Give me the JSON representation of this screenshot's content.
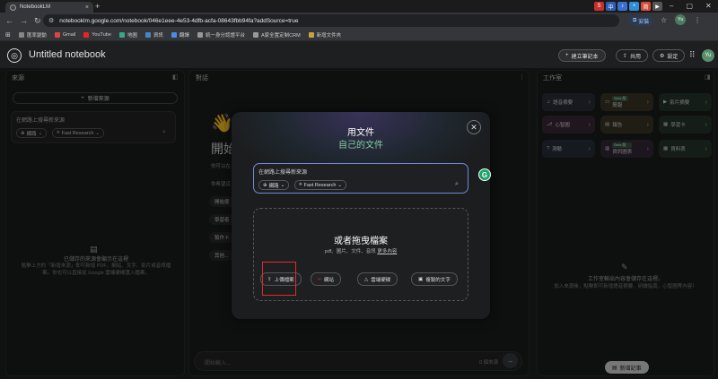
{
  "browser": {
    "tab_title": "NotebookLM",
    "url": "notebooklm.google.com/notebook/046e1eee-4e53-4dfb-acfa-08643fbb94fa?addSource=true",
    "install_label": "安裝",
    "profile_initials": "Yu",
    "extensions": [
      "S",
      "中",
      "♪",
      "•",
      "简",
      "▶"
    ],
    "bookmarks": [
      "匯率變動",
      "Gmail",
      "YouTube",
      "地圖",
      "資訊",
      "翻譯",
      "統一身分認證平台",
      "A家全置定制CRM",
      "新增文件夾"
    ]
  },
  "app": {
    "notebook_title": "Untitled notebook",
    "create_label": "建立筆記本",
    "share_label": "共用",
    "settings_label": "設定",
    "avatar_initials": "Yu"
  },
  "sources": {
    "header": "來源",
    "add_label": "新增來源",
    "search_placeholder": "在網路上搜尋新來源",
    "chip_web": "網路",
    "chip_fast": "Fast Research",
    "empty_title": "已儲存的來源會顯示在這裡",
    "empty_desc_1": "點擊上方的「新增來源」即可新增 PDF、網站、文字、影片或音訊檔",
    "empty_desc_2": "案。你也可以直接從 Google 雲端硬碟匯入檔案。"
  },
  "chat": {
    "header": "對話",
    "big_title": "開始",
    "sub1": "你可以在",
    "sub2": "你希望這",
    "chips": [
      "開始使",
      "學習者",
      "製作 F",
      "其他..."
    ],
    "input_placeholder": "開始輸入...",
    "source_count": "0 個來源"
  },
  "studio": {
    "header": "工作室",
    "tiles": [
      {
        "label": "語音摘要",
        "icon": "♫",
        "color": "#2b2f3a",
        "beta": ""
      },
      {
        "label": "簡報",
        "icon": "▭",
        "color": "#3a3525",
        "beta": "Beta 版"
      },
      {
        "label": "影片摘要",
        "icon": "▶",
        "color": "#25352b",
        "beta": ""
      },
      {
        "label": "心智圖",
        "icon": "⎇",
        "color": "#3a2b36",
        "beta": ""
      },
      {
        "label": "報告",
        "icon": "▤",
        "color": "#3a3525",
        "beta": ""
      },
      {
        "label": "學習卡",
        "icon": "▦",
        "color": "#25352b",
        "beta": ""
      },
      {
        "label": "測驗",
        "icon": "?",
        "color": "#25303a",
        "beta": ""
      },
      {
        "label": "資訊圖表",
        "icon": "▥",
        "color": "#34283a",
        "beta": "Beta 版"
      },
      {
        "label": "資料表",
        "icon": "▦",
        "color": "#25352b",
        "beta": ""
      }
    ],
    "empty_title": "工作室輸出內容會儲存在這裡。",
    "empty_desc": "加入來源後，點擊即可新增語音摘要、研讀指南、心智圖等內容！",
    "add_note_label": "新增記事"
  },
  "modal": {
    "title": "用文件",
    "subtitle": "自己的文件",
    "search_placeholder": "在網路上搜尋新來源",
    "chip_web": "網路",
    "chip_fast": "Fast Research",
    "drop_title": "或者拖曳檔案",
    "drop_types": "pdf、圖片、文件、音訊",
    "drop_more": "更多內容",
    "upload_label": "上傳檔案",
    "website_label": "網站",
    "drive_label": "雲端硬碟",
    "paste_label": "複製的文字"
  }
}
